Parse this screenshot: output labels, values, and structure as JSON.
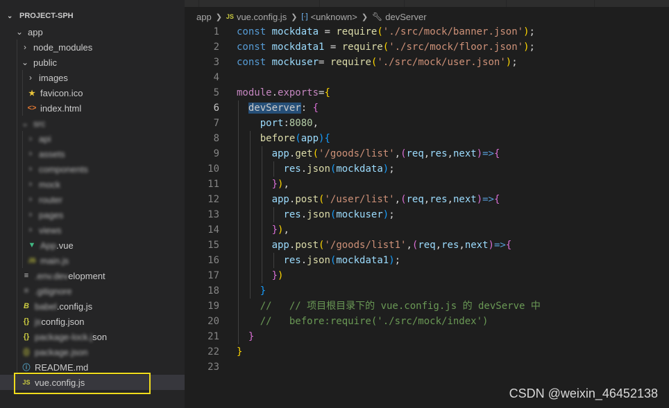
{
  "explorer": {
    "project_title": "PROJECT-SPH",
    "items": [
      {
        "label": "app",
        "type": "folder-open",
        "depth": 0
      },
      {
        "label": "node_modules",
        "type": "folder",
        "depth": 1
      },
      {
        "label": "public",
        "type": "folder-open",
        "depth": 1
      },
      {
        "label": "images",
        "type": "folder",
        "depth": 2
      },
      {
        "label": "favicon.ico",
        "type": "star",
        "depth": 2
      },
      {
        "label": "index.html",
        "type": "html",
        "depth": 2
      },
      {
        "label": "src",
        "type": "folder-open",
        "depth": 1,
        "blur": true
      },
      {
        "label": "api",
        "type": "folder",
        "depth": 2,
        "blur": true
      },
      {
        "label": "assets",
        "type": "file",
        "depth": 2,
        "blur": true
      },
      {
        "label": "components",
        "type": "file",
        "depth": 2,
        "blur": true
      },
      {
        "label": "mock",
        "type": "file",
        "depth": 2,
        "blur": true
      },
      {
        "label": "router",
        "type": "file",
        "depth": 2,
        "blur": true
      },
      {
        "label": "pages",
        "type": "file",
        "depth": 2,
        "blur": true
      },
      {
        "label": "views",
        "type": "file",
        "depth": 2,
        "blur": true
      },
      {
        "label": "App.vue",
        "type": "vue",
        "depth": 2,
        "blur_prefix": "App",
        "suffix": ".vue"
      },
      {
        "label": "main.js",
        "type": "js",
        "depth": 2,
        "blur": true
      },
      {
        "label": ".env.development",
        "type": "lines",
        "depth": 1,
        "blur_prefix": ".env.dev",
        "suffix": "elopment"
      },
      {
        "label": ".gitignore",
        "type": "lines",
        "depth": 1,
        "blur": true
      },
      {
        "label": "babel.config.js",
        "type": "babel",
        "depth": 1,
        "blur_prefix": "babel",
        "suffix": ".config.js"
      },
      {
        "label": "jsconfig.json",
        "type": "json",
        "depth": 1,
        "blur_prefix": "js",
        "suffix": "config.json"
      },
      {
        "label": "package-lock.json",
        "type": "json",
        "depth": 1,
        "blur_prefix": "package-lock.j",
        "suffix": "son"
      },
      {
        "label": "package.json",
        "type": "json",
        "depth": 1,
        "blur": true
      },
      {
        "label": "README.md",
        "type": "info",
        "depth": 1
      },
      {
        "label": "vue.config.js",
        "type": "js",
        "depth": 1,
        "selected": true
      }
    ]
  },
  "breadcrumb": {
    "folder": "app",
    "file": "vue.config.js",
    "symbol": "<unknown>",
    "member": "devServer"
  },
  "editor": {
    "active_line": 6,
    "lines": [
      {
        "n": "1",
        "tokens": [
          [
            "kw",
            "const "
          ],
          [
            "var",
            "mockdata"
          ],
          [
            "pl",
            " = "
          ],
          [
            "fn",
            "require"
          ],
          [
            "br1",
            "("
          ],
          [
            "str",
            "'./src/mock/banner.json'"
          ],
          [
            "br1",
            ")"
          ],
          [
            "pl",
            ";"
          ]
        ]
      },
      {
        "n": "2",
        "tokens": [
          [
            "kw",
            "const "
          ],
          [
            "var",
            "mockdata1"
          ],
          [
            "pl",
            " = "
          ],
          [
            "fn",
            "require"
          ],
          [
            "br1",
            "("
          ],
          [
            "str",
            "'./src/mock/floor.json'"
          ],
          [
            "br1",
            ")"
          ],
          [
            "pl",
            ";"
          ]
        ]
      },
      {
        "n": "3",
        "tokens": [
          [
            "kw",
            "const "
          ],
          [
            "var",
            "mockuser"
          ],
          [
            "pl",
            "= "
          ],
          [
            "fn",
            "require"
          ],
          [
            "br1",
            "("
          ],
          [
            "str",
            "'./src/mock/user.json'"
          ],
          [
            "br1",
            ")"
          ],
          [
            "pl",
            ";"
          ]
        ]
      },
      {
        "n": "4",
        "tokens": []
      },
      {
        "n": "5",
        "tokens": [
          [
            "ctl",
            "module"
          ],
          [
            "pl",
            "."
          ],
          [
            "ctl",
            "exports"
          ],
          [
            "pl",
            "="
          ],
          [
            "br1",
            "{"
          ]
        ]
      },
      {
        "n": "6",
        "tokens": [
          [
            "pl",
            "  "
          ],
          [
            "sel",
            "devServer"
          ],
          [
            "pl",
            ": "
          ],
          [
            "br2",
            "{"
          ]
        ]
      },
      {
        "n": "7",
        "tokens": [
          [
            "pl",
            "    "
          ],
          [
            "var",
            "port"
          ],
          [
            "pl",
            ":"
          ],
          [
            "num",
            "8080"
          ],
          [
            "pl",
            ","
          ]
        ]
      },
      {
        "n": "8",
        "tokens": [
          [
            "pl",
            "    "
          ],
          [
            "fn",
            "before"
          ],
          [
            "br3",
            "("
          ],
          [
            "var",
            "app"
          ],
          [
            "br3",
            ")"
          ],
          [
            "br3",
            "{"
          ]
        ]
      },
      {
        "n": "9",
        "tokens": [
          [
            "pl",
            "      "
          ],
          [
            "var",
            "app"
          ],
          [
            "pl",
            "."
          ],
          [
            "fn",
            "get"
          ],
          [
            "br1",
            "("
          ],
          [
            "str",
            "'/goods/list'"
          ],
          [
            "pl",
            ","
          ],
          [
            "br2",
            "("
          ],
          [
            "var",
            "req"
          ],
          [
            "pl",
            ","
          ],
          [
            "var",
            "res"
          ],
          [
            "pl",
            ","
          ],
          [
            "var",
            "next"
          ],
          [
            "br2",
            ")"
          ],
          [
            "kw",
            "=>"
          ],
          [
            "br2",
            "{"
          ]
        ]
      },
      {
        "n": "10",
        "tokens": [
          [
            "pl",
            "        "
          ],
          [
            "var",
            "res"
          ],
          [
            "pl",
            "."
          ],
          [
            "fn",
            "json"
          ],
          [
            "br3",
            "("
          ],
          [
            "var",
            "mockdata"
          ],
          [
            "br3",
            ")"
          ],
          [
            "pl",
            ";"
          ]
        ]
      },
      {
        "n": "11",
        "tokens": [
          [
            "pl",
            "      "
          ],
          [
            "br2",
            "}"
          ],
          [
            "br1",
            ")"
          ],
          [
            "pl",
            ","
          ]
        ]
      },
      {
        "n": "12",
        "tokens": [
          [
            "pl",
            "      "
          ],
          [
            "var",
            "app"
          ],
          [
            "pl",
            "."
          ],
          [
            "fn",
            "post"
          ],
          [
            "br1",
            "("
          ],
          [
            "str",
            "'/user/list'"
          ],
          [
            "pl",
            ","
          ],
          [
            "br2",
            "("
          ],
          [
            "var",
            "req"
          ],
          [
            "pl",
            ","
          ],
          [
            "var",
            "res"
          ],
          [
            "pl",
            ","
          ],
          [
            "var",
            "next"
          ],
          [
            "br2",
            ")"
          ],
          [
            "kw",
            "=>"
          ],
          [
            "br2",
            "{"
          ]
        ]
      },
      {
        "n": "13",
        "tokens": [
          [
            "pl",
            "        "
          ],
          [
            "var",
            "res"
          ],
          [
            "pl",
            "."
          ],
          [
            "fn",
            "json"
          ],
          [
            "br3",
            "("
          ],
          [
            "var",
            "mockuser"
          ],
          [
            "br3",
            ")"
          ],
          [
            "pl",
            ";"
          ]
        ]
      },
      {
        "n": "14",
        "tokens": [
          [
            "pl",
            "      "
          ],
          [
            "br2",
            "}"
          ],
          [
            "br1",
            ")"
          ],
          [
            "pl",
            ","
          ]
        ]
      },
      {
        "n": "15",
        "tokens": [
          [
            "pl",
            "      "
          ],
          [
            "var",
            "app"
          ],
          [
            "pl",
            "."
          ],
          [
            "fn",
            "post"
          ],
          [
            "br1",
            "("
          ],
          [
            "str",
            "'/goods/list1'"
          ],
          [
            "pl",
            ","
          ],
          [
            "br2",
            "("
          ],
          [
            "var",
            "req"
          ],
          [
            "pl",
            ","
          ],
          [
            "var",
            "res"
          ],
          [
            "pl",
            ","
          ],
          [
            "var",
            "next"
          ],
          [
            "br2",
            ")"
          ],
          [
            "kw",
            "=>"
          ],
          [
            "br2",
            "{"
          ]
        ]
      },
      {
        "n": "16",
        "tokens": [
          [
            "pl",
            "        "
          ],
          [
            "var",
            "res"
          ],
          [
            "pl",
            "."
          ],
          [
            "fn",
            "json"
          ],
          [
            "br3",
            "("
          ],
          [
            "var",
            "mockdata1"
          ],
          [
            "br3",
            ")"
          ],
          [
            "pl",
            ";"
          ]
        ]
      },
      {
        "n": "17",
        "tokens": [
          [
            "pl",
            "      "
          ],
          [
            "br2",
            "}"
          ],
          [
            "br1",
            ")"
          ]
        ]
      },
      {
        "n": "18",
        "tokens": [
          [
            "pl",
            "    "
          ],
          [
            "br3",
            "}"
          ]
        ]
      },
      {
        "n": "19",
        "tokens": [
          [
            "pl",
            "    "
          ],
          [
            "cm",
            "//   // 项目根目录下的 vue.config.js 的 devServe 中"
          ]
        ]
      },
      {
        "n": "20",
        "tokens": [
          [
            "pl",
            "    "
          ],
          [
            "cm",
            "//   before:require('./src/mock/index')"
          ]
        ]
      },
      {
        "n": "21",
        "tokens": [
          [
            "pl",
            "  "
          ],
          [
            "br2",
            "}"
          ]
        ]
      },
      {
        "n": "22",
        "tokens": [
          [
            "br1",
            "}"
          ]
        ]
      },
      {
        "n": "23",
        "tokens": []
      }
    ]
  },
  "watermark": "CSDN @weixin_46452138"
}
